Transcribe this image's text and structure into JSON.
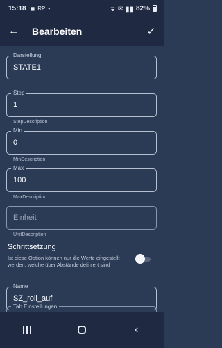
{
  "status_bar": {
    "time": "15:18",
    "left_icons": [
      "◼",
      "RP",
      "•"
    ],
    "right_icons": "ᯤ ✉ ▮▮",
    "battery": "82%"
  },
  "app_bar": {
    "back_icon": "←",
    "title": "Bearbeiten",
    "confirm_icon": "✓"
  },
  "form": {
    "darstellung": {
      "label": "Darstellung",
      "value": "STATE1"
    },
    "step": {
      "label": "Step",
      "value": "1",
      "helper": "StepDescription"
    },
    "min": {
      "label": "Min",
      "value": "0",
      "helper": "MinDescription"
    },
    "max": {
      "label": "Max",
      "value": "100",
      "helper": "MaxDescription"
    },
    "einheit": {
      "placeholder": "Einheit",
      "helper": "UnitDescription"
    },
    "schrittsetzung": {
      "title": "Schrittsetzung",
      "description": "Ist diese Option können nur die Werte eingestellt werden, welche über Abstände definiert sind",
      "enabled": false
    },
    "name": {
      "label": "Name",
      "value": "SZ_roll_auf"
    },
    "tab": {
      "label": "Tab Einstellungen"
    }
  },
  "nav_bar": {
    "recent": "|||",
    "home": "○",
    "back": "‹"
  },
  "colors": {
    "background": "#2b3a55",
    "bar": "#1f2a42",
    "border": "#8a96ad"
  }
}
